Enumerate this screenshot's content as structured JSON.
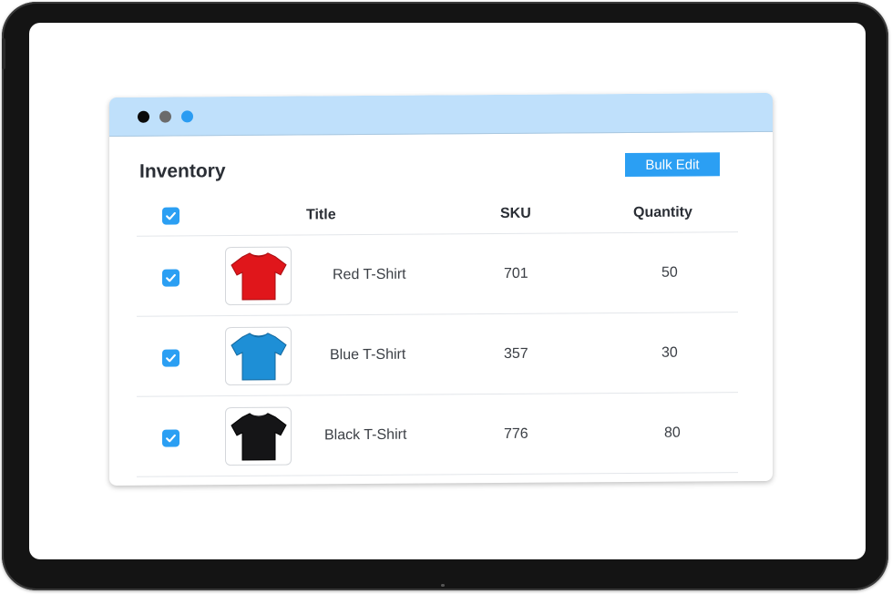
{
  "window": {
    "dots": [
      {
        "name": "close",
        "color": "#0a0a0a"
      },
      {
        "name": "minimize",
        "color": "#6b6b6b"
      },
      {
        "name": "maximize",
        "color": "#2b9cf2"
      }
    ]
  },
  "page": {
    "title": "Inventory",
    "bulk_edit_label": "Bulk Edit"
  },
  "table": {
    "headers": {
      "select_all_checked": true,
      "title": "Title",
      "sku": "SKU",
      "quantity": "Quantity"
    },
    "rows": [
      {
        "checked": true,
        "title": "Red T-Shirt",
        "sku": "701",
        "quantity": "50",
        "image": "red-tshirt-image",
        "color": "#e0161b"
      },
      {
        "checked": true,
        "title": "Blue T-Shirt",
        "sku": "357",
        "quantity": "30",
        "image": "blue-tshirt-image",
        "color": "#1e8fd6"
      },
      {
        "checked": true,
        "title": "Black T-Shirt",
        "sku": "776",
        "quantity": "80",
        "image": "black-tshirt-image",
        "color": "#151517"
      }
    ]
  },
  "colors": {
    "accent": "#2b9ff3",
    "titlebar": "#bfe0fb",
    "device": "#141414"
  }
}
